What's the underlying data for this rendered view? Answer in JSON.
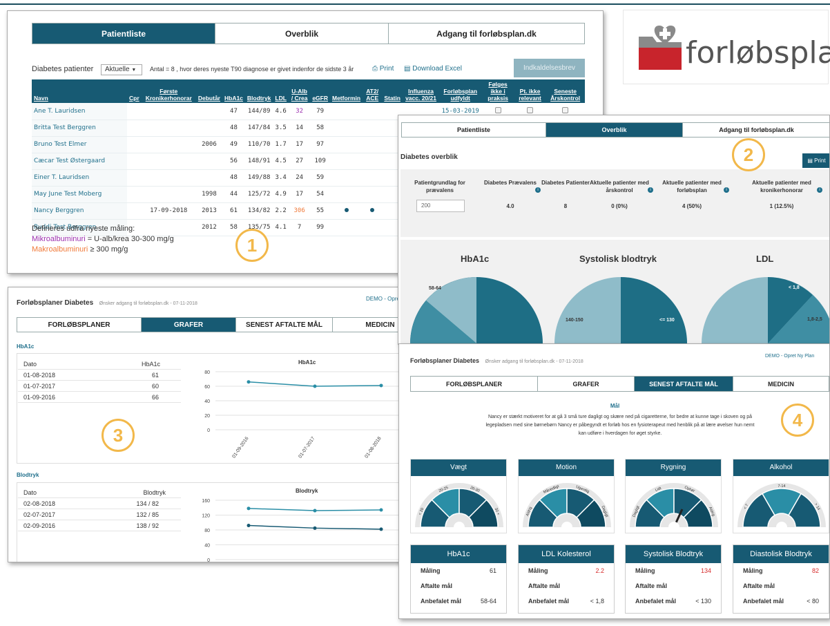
{
  "logo": {
    "text": "forløbsplan"
  },
  "p1": {
    "tabs": [
      "Patientliste",
      "Overblik",
      "Adgang til forløbsplan.dk"
    ],
    "filter_label": "Diabetes patienter",
    "filter_value": "Aktuelle",
    "count_text": "Antal = 8 , hvor deres nyeste T90 diagnose er givet indenfor de sidste 3 år",
    "print": "Print",
    "download": "Download Excel",
    "letter_btn": "Indkaldelsesbrev",
    "columns": [
      "Navn",
      "Cpr",
      "Første Kronikerhonorar",
      "Debutår",
      "HbA1c",
      "Blodtryk",
      "LDL",
      "U-Alb / Crea",
      "eGFR",
      "Metformin",
      "AT2/ ACE",
      "Statin",
      "Influenza vacc. 20/21",
      "Forløbsplan udfyldt",
      "Følges ikke i praksis",
      "Pt. ikke relevant",
      "Seneste Årskontrol"
    ],
    "rows": [
      {
        "name": "Ane T. Lauridsen",
        "first": "",
        "debut": "",
        "hba1c": "47",
        "bp": "144/89",
        "ldl": "4.6",
        "ualb": "32",
        "egfr": "79",
        "met": false,
        "at2": false,
        "plan": "15-03-2019"
      },
      {
        "name": "Britta Test Berggren",
        "first": "",
        "debut": "",
        "hba1c": "48",
        "bp": "147/84",
        "ldl": "3.5",
        "ualb": "14",
        "egfr": "58",
        "met": false,
        "at2": false,
        "plan": ""
      },
      {
        "name": "Bruno Test Elmer",
        "first": "",
        "debut": "2006",
        "hba1c": "49",
        "bp": "110/70",
        "ldl": "1.7",
        "ualb": "17",
        "egfr": "97",
        "met": false,
        "at2": false,
        "plan": ""
      },
      {
        "name": "Cæcar Test Østergaard",
        "first": "",
        "debut": "",
        "hba1c": "56",
        "bp": "148/91",
        "ldl": "4.5",
        "ualb": "27",
        "egfr": "109",
        "met": false,
        "at2": false,
        "plan": ""
      },
      {
        "name": "Einer T. Lauridsen",
        "first": "",
        "debut": "",
        "hba1c": "48",
        "bp": "149/88",
        "ldl": "3.4",
        "ualb": "24",
        "egfr": "59",
        "met": false,
        "at2": false,
        "plan": ""
      },
      {
        "name": "May June Test Moberg",
        "first": "",
        "debut": "1998",
        "hba1c": "44",
        "bp": "125/72",
        "ldl": "4.9",
        "ualb": "17",
        "egfr": "54",
        "met": false,
        "at2": false,
        "plan": ""
      },
      {
        "name": "Nancy Berggren",
        "first": "17-09-2018",
        "debut": "2013",
        "hba1c": "61",
        "bp": "134/82",
        "ldl": "2.2",
        "ualb": "306",
        "egfr": "55",
        "met": true,
        "at2": true,
        "plan": ""
      },
      {
        "name": "Ruddi Test Berggren",
        "first": "",
        "debut": "2012",
        "hba1c": "58",
        "bp": "135/75",
        "ldl": "4.1",
        "ualb": "7",
        "egfr": "99",
        "met": false,
        "at2": false,
        "plan": ""
      }
    ],
    "legend_title": "Defineres udfra nyeste måling:",
    "legend_micro_name": "Mikroalbuminuri",
    "legend_micro_rest": " = U-alb/krea 30-300 mg/g",
    "legend_macro_name": "Makroalbuminuri",
    "legend_macro_rest": " ≥ 300 mg/g",
    "badge": "1",
    "colors": {
      "micro": "#9b2fae",
      "macro": "#f07a3a"
    }
  },
  "p2": {
    "tabs": [
      "Patientliste",
      "Overblik",
      "Adgang til forløbsplan.dk"
    ],
    "title": "Diabetes overblik",
    "print": "Print",
    "stats": [
      {
        "label": "Patientgrundlag for prævalens",
        "value": "200",
        "input": true
      },
      {
        "label": "Diabetes Prævalens",
        "value": "4.0",
        "info": true
      },
      {
        "label": "Diabetes Patienter",
        "value": "8"
      },
      {
        "label": "Aktuelle patienter med årskontrol",
        "value": "0 (0%)",
        "info": true
      },
      {
        "label": "Aktuelle patienter med forløbsplan",
        "value": "4 (50%)",
        "info": true
      },
      {
        "label": "Aktuelle patienter med kronikerhonorar",
        "value": "1 (12.5%)",
        "info": true
      }
    ],
    "charts": [
      {
        "title": "HbA1c",
        "labels": [
          "58-64"
        ]
      },
      {
        "title": "Systolisk blodtryk",
        "labels": [
          "140-150",
          "<= 130"
        ]
      },
      {
        "title": "LDL",
        "labels": [
          "< 1,8",
          "1,8-2,5"
        ]
      }
    ],
    "badge": "2"
  },
  "p3": {
    "title": "Forløbsplaner Diabetes",
    "subtitle": "Ønsker adgang til forløbsplan.dk - 07-11-2018",
    "demo": "DEMO",
    "sep": "-",
    "new_plan": "Opret Ny Plan",
    "tabs": [
      "FORLØBSPLANER",
      "GRAFER",
      "SENEST AFTALTE MÅL",
      "MEDICIN"
    ],
    "hba1c": {
      "section": "HbA1c",
      "col1": "Dato",
      "col2": "HbA1c",
      "rows": [
        [
          "01-08-2018",
          "61"
        ],
        [
          "01-07-2017",
          "60"
        ],
        [
          "01-09-2016",
          "66"
        ]
      ],
      "chart_title": "HbA1c",
      "yticks": [
        "80",
        "60",
        "40",
        "20",
        "0"
      ],
      "xticks": [
        "01-09-2016",
        "01-07-2017",
        "01-08-2018"
      ]
    },
    "bp": {
      "section": "Blodtryk",
      "col1": "Dato",
      "col2": "Blodtryk",
      "rows": [
        [
          "02-08-2018",
          "134 / 82"
        ],
        [
          "02-07-2017",
          "132 / 85"
        ],
        [
          "02-09-2016",
          "138 / 92"
        ]
      ],
      "chart_title": "Blodtryk",
      "yticks": [
        "160",
        "120",
        "80",
        "40",
        "0"
      ]
    },
    "badge": "3"
  },
  "p4": {
    "title": "Forløbsplaner Diabetes",
    "subtitle": "Ønsker adgang til forløbsplan.dk - 07-11-2018",
    "demo": "DEMO",
    "sep": "-",
    "new_plan": "Opret Ny Plan",
    "tabs": [
      "FORLØBSPLANER",
      "GRAFER",
      "SENEST AFTALTE MÅL",
      "MEDICIN"
    ],
    "goal_title": "Mål",
    "goal_text": "Nancy er stærkt motiveret for at gå 3 små ture dagligt og skære ned på cigaretterne, for bedre at kunne tage i skoven og på legepladsen med sine børnebørn Nancy er påbegyndt et forløb hos en fysioterapeut med henblik på at lære øvelser hun nemt kan udføre i hverdagen for øget styrke.",
    "gauges": [
      {
        "title": "Vægt",
        "labels": [
          "< 20",
          "20-25",
          "26-30",
          "30 +"
        ]
      },
      {
        "title": "Motion",
        "labels": [
          "Aldrig",
          "Månedligt",
          "Ugentlig",
          "Dagligt"
        ]
      },
      {
        "title": "Rygning",
        "labels": [
          "Dagligt",
          "Lidt",
          "Ophør",
          "Aldrig"
        ]
      },
      {
        "title": "Alkohol",
        "labels": [
          "< 7",
          "7-14",
          "> 14"
        ]
      }
    ],
    "cards": [
      {
        "title": "HbA1c",
        "measure": "61",
        "agreed": "",
        "recommended": "58-64",
        "red": false
      },
      {
        "title": "LDL Kolesterol",
        "measure": "2.2",
        "agreed": "",
        "recommended": "< 1,8",
        "red": true
      },
      {
        "title": "Systolisk Blodtryk",
        "measure": "134",
        "agreed": "",
        "recommended": "< 130",
        "red": true
      },
      {
        "title": "Diastolisk Blodtryk",
        "measure": "82",
        "agreed": "",
        "recommended": "< 80",
        "red": true
      }
    ],
    "row_labels": {
      "measure": "Måling",
      "agreed": "Aftalte mål",
      "recommended": "Anbefalet mål"
    },
    "badge": "4"
  },
  "chart_data": [
    {
      "type": "line",
      "title": "HbA1c",
      "x": [
        "01-09-2016",
        "01-07-2017",
        "01-08-2018"
      ],
      "series": [
        {
          "values": [
            66,
            60,
            61
          ]
        }
      ],
      "ylim": [
        0,
        80
      ]
    },
    {
      "type": "line",
      "title": "Blodtryk",
      "x": [
        "02-09-2016",
        "02-07-2017",
        "02-08-2018"
      ],
      "series": [
        {
          "values": [
            138,
            132,
            134
          ]
        },
        {
          "values": [
            92,
            85,
            82
          ]
        }
      ],
      "ylim": [
        0,
        160
      ]
    }
  ]
}
